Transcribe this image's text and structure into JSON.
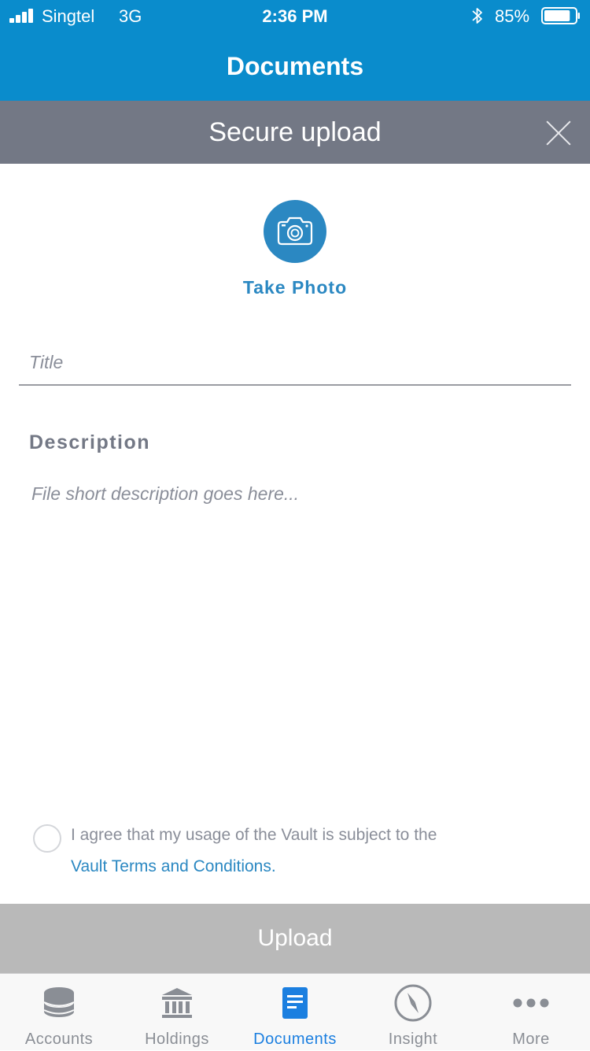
{
  "status_bar": {
    "carrier": "Singtel",
    "network": "3G",
    "time": "2:36 PM",
    "battery_percent": "85%",
    "battery_level": 0.85
  },
  "nav": {
    "title": "Documents"
  },
  "sheet": {
    "title": "Secure upload"
  },
  "photo": {
    "label": "Take Photo",
    "icon": "camera-icon"
  },
  "form": {
    "title_placeholder": "Title",
    "title_value": "",
    "description_label": "Description",
    "description_placeholder": "File short description goes here...",
    "description_value": ""
  },
  "agreement": {
    "checked": false,
    "text": "I agree that my usage of the Vault is subject to the",
    "link_text": "Vault Terms and Conditions."
  },
  "upload": {
    "label": "Upload"
  },
  "tabs": [
    {
      "label": "Accounts",
      "icon": "database-icon",
      "active": false
    },
    {
      "label": "Holdings",
      "icon": "bank-icon",
      "active": false
    },
    {
      "label": "Documents",
      "icon": "document-icon",
      "active": true
    },
    {
      "label": "Insight",
      "icon": "compass-icon",
      "active": false
    },
    {
      "label": "More",
      "icon": "more-dots-icon",
      "active": false
    }
  ],
  "colors": {
    "brand_blue": "#0a8ccc",
    "accent_blue": "#2b88c2",
    "active_tab": "#1b7fe0",
    "header_gray": "#737885",
    "upload_disabled": "#b9b9b9"
  }
}
